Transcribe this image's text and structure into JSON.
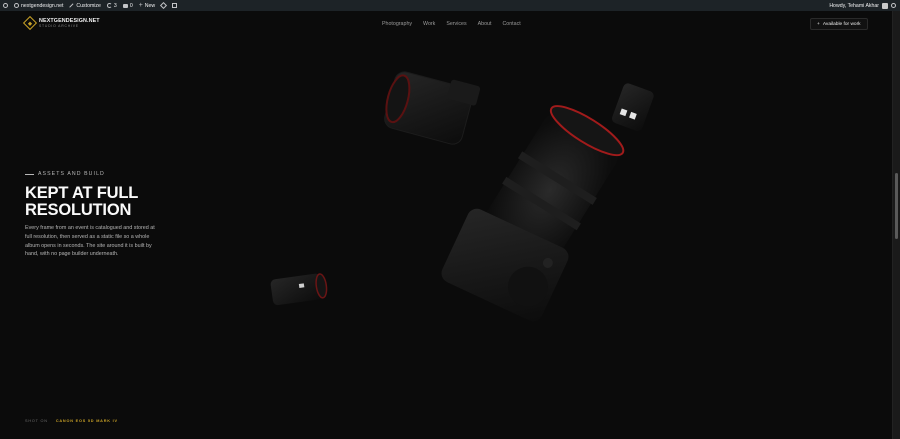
{
  "admin_bar": {
    "site_name": "nextgendesign.net",
    "customize": "Customize",
    "updates_count": "3",
    "comments_count": "0",
    "new": "New",
    "greeting": "Howdy, Tehami Akhar"
  },
  "header": {
    "logo_name": "NEXTGENDESIGN.NET",
    "logo_sub": "STUDIO ARCHIVE",
    "nav": [
      "Photography",
      "Work",
      "Services",
      "About",
      "Contact"
    ],
    "cta_label": "Available for work",
    "accent_color": "#c9a227"
  },
  "hero": {
    "eyebrow": "ASSETS AND BUILD",
    "title_line1": "KEPT AT FULL",
    "title_line2": "RESOLUTION",
    "body": "Every frame from an event is catalogued and stored at full resolution, then served as a static file so a whole album opens in seconds. The site around it is built by hand, with no page builder underneath."
  },
  "footer": {
    "label": "SHOT ON",
    "value": "CANON EOS 5D MARK IV"
  }
}
